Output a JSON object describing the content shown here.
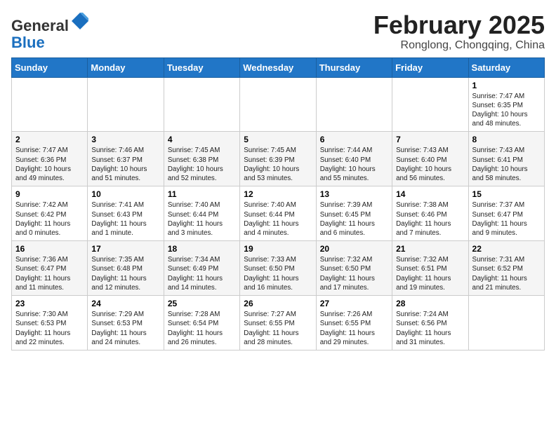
{
  "header": {
    "logo_general": "General",
    "logo_blue": "Blue",
    "month_title": "February 2025",
    "subtitle": "Ronglong, Chongqing, China"
  },
  "weekdays": [
    "Sunday",
    "Monday",
    "Tuesday",
    "Wednesday",
    "Thursday",
    "Friday",
    "Saturday"
  ],
  "weeks": [
    [
      {
        "day": "",
        "info": ""
      },
      {
        "day": "",
        "info": ""
      },
      {
        "day": "",
        "info": ""
      },
      {
        "day": "",
        "info": ""
      },
      {
        "day": "",
        "info": ""
      },
      {
        "day": "",
        "info": ""
      },
      {
        "day": "1",
        "info": "Sunrise: 7:47 AM\nSunset: 6:35 PM\nDaylight: 10 hours\nand 48 minutes."
      }
    ],
    [
      {
        "day": "2",
        "info": "Sunrise: 7:47 AM\nSunset: 6:36 PM\nDaylight: 10 hours\nand 49 minutes."
      },
      {
        "day": "3",
        "info": "Sunrise: 7:46 AM\nSunset: 6:37 PM\nDaylight: 10 hours\nand 51 minutes."
      },
      {
        "day": "4",
        "info": "Sunrise: 7:45 AM\nSunset: 6:38 PM\nDaylight: 10 hours\nand 52 minutes."
      },
      {
        "day": "5",
        "info": "Sunrise: 7:45 AM\nSunset: 6:39 PM\nDaylight: 10 hours\nand 53 minutes."
      },
      {
        "day": "6",
        "info": "Sunrise: 7:44 AM\nSunset: 6:40 PM\nDaylight: 10 hours\nand 55 minutes."
      },
      {
        "day": "7",
        "info": "Sunrise: 7:43 AM\nSunset: 6:40 PM\nDaylight: 10 hours\nand 56 minutes."
      },
      {
        "day": "8",
        "info": "Sunrise: 7:43 AM\nSunset: 6:41 PM\nDaylight: 10 hours\nand 58 minutes."
      }
    ],
    [
      {
        "day": "9",
        "info": "Sunrise: 7:42 AM\nSunset: 6:42 PM\nDaylight: 11 hours\nand 0 minutes."
      },
      {
        "day": "10",
        "info": "Sunrise: 7:41 AM\nSunset: 6:43 PM\nDaylight: 11 hours\nand 1 minute."
      },
      {
        "day": "11",
        "info": "Sunrise: 7:40 AM\nSunset: 6:44 PM\nDaylight: 11 hours\nand 3 minutes."
      },
      {
        "day": "12",
        "info": "Sunrise: 7:40 AM\nSunset: 6:44 PM\nDaylight: 11 hours\nand 4 minutes."
      },
      {
        "day": "13",
        "info": "Sunrise: 7:39 AM\nSunset: 6:45 PM\nDaylight: 11 hours\nand 6 minutes."
      },
      {
        "day": "14",
        "info": "Sunrise: 7:38 AM\nSunset: 6:46 PM\nDaylight: 11 hours\nand 7 minutes."
      },
      {
        "day": "15",
        "info": "Sunrise: 7:37 AM\nSunset: 6:47 PM\nDaylight: 11 hours\nand 9 minutes."
      }
    ],
    [
      {
        "day": "16",
        "info": "Sunrise: 7:36 AM\nSunset: 6:47 PM\nDaylight: 11 hours\nand 11 minutes."
      },
      {
        "day": "17",
        "info": "Sunrise: 7:35 AM\nSunset: 6:48 PM\nDaylight: 11 hours\nand 12 minutes."
      },
      {
        "day": "18",
        "info": "Sunrise: 7:34 AM\nSunset: 6:49 PM\nDaylight: 11 hours\nand 14 minutes."
      },
      {
        "day": "19",
        "info": "Sunrise: 7:33 AM\nSunset: 6:50 PM\nDaylight: 11 hours\nand 16 minutes."
      },
      {
        "day": "20",
        "info": "Sunrise: 7:32 AM\nSunset: 6:50 PM\nDaylight: 11 hours\nand 17 minutes."
      },
      {
        "day": "21",
        "info": "Sunrise: 7:32 AM\nSunset: 6:51 PM\nDaylight: 11 hours\nand 19 minutes."
      },
      {
        "day": "22",
        "info": "Sunrise: 7:31 AM\nSunset: 6:52 PM\nDaylight: 11 hours\nand 21 minutes."
      }
    ],
    [
      {
        "day": "23",
        "info": "Sunrise: 7:30 AM\nSunset: 6:53 PM\nDaylight: 11 hours\nand 22 minutes."
      },
      {
        "day": "24",
        "info": "Sunrise: 7:29 AM\nSunset: 6:53 PM\nDaylight: 11 hours\nand 24 minutes."
      },
      {
        "day": "25",
        "info": "Sunrise: 7:28 AM\nSunset: 6:54 PM\nDaylight: 11 hours\nand 26 minutes."
      },
      {
        "day": "26",
        "info": "Sunrise: 7:27 AM\nSunset: 6:55 PM\nDaylight: 11 hours\nand 28 minutes."
      },
      {
        "day": "27",
        "info": "Sunrise: 7:26 AM\nSunset: 6:55 PM\nDaylight: 11 hours\nand 29 minutes."
      },
      {
        "day": "28",
        "info": "Sunrise: 7:24 AM\nSunset: 6:56 PM\nDaylight: 11 hours\nand 31 minutes."
      },
      {
        "day": "",
        "info": ""
      }
    ]
  ]
}
